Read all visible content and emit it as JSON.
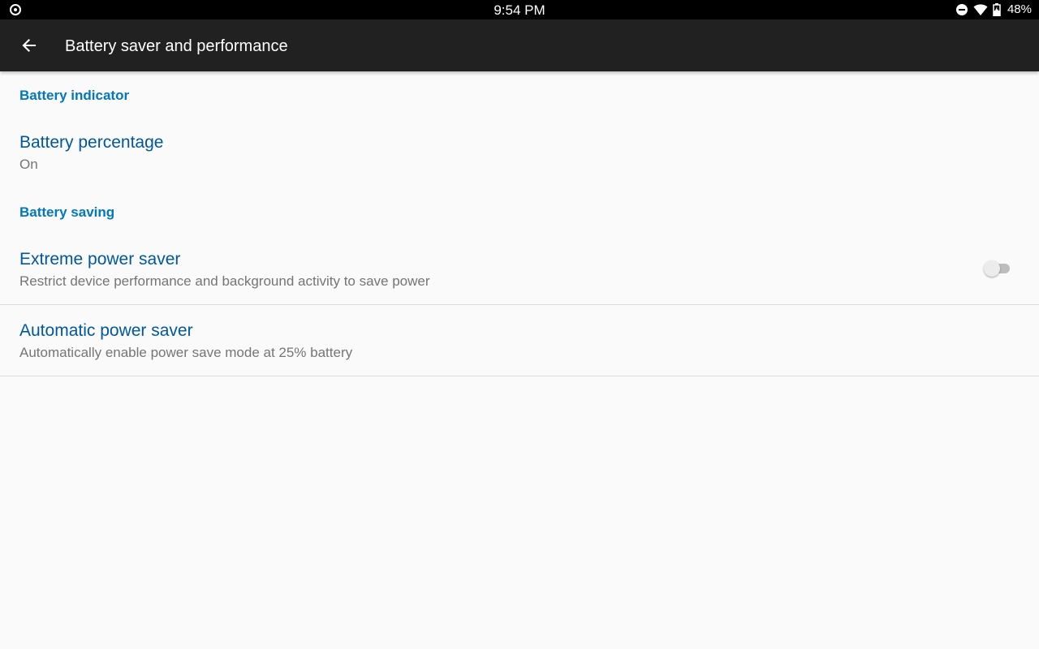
{
  "status_bar": {
    "time": "9:54 PM",
    "battery_percent": "48%",
    "icons": [
      "location-target-icon",
      "do-not-disturb-icon",
      "wifi-icon",
      "battery-icon"
    ]
  },
  "app_bar": {
    "title": "Battery saver and performance",
    "back_icon": "arrow-back-icon"
  },
  "sections": {
    "indicator": {
      "header": "Battery indicator",
      "battery_percentage": {
        "title": "Battery percentage",
        "summary": "On"
      }
    },
    "saving": {
      "header": "Battery saving",
      "extreme": {
        "title": "Extreme power saver",
        "summary": "Restrict device performance and background activity to save power",
        "enabled": false
      },
      "automatic": {
        "title": "Automatic power saver",
        "summary": "Automatically enable power save mode at 25% battery"
      }
    }
  },
  "colors": {
    "category": "#0277bd",
    "title": "#01579b",
    "summary": "#757575",
    "app_bar": "#212121",
    "status_bar": "#000000",
    "background": "#fafafa"
  }
}
